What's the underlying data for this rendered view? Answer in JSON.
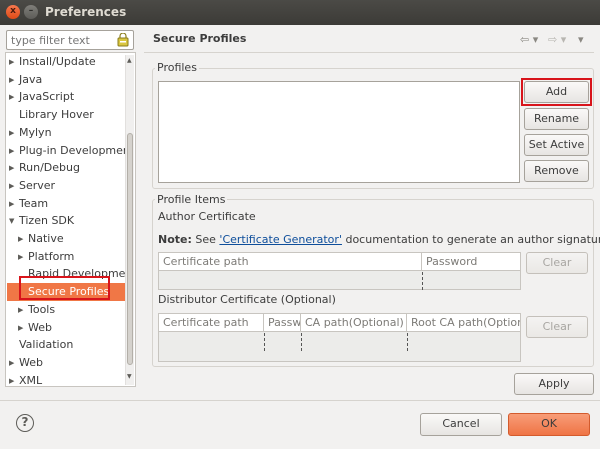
{
  "window": {
    "title": "Preferences",
    "close_glyph": "x",
    "min_glyph": "–"
  },
  "filter": {
    "placeholder": "type filter text",
    "icon": "clear-filter-icon"
  },
  "tree": {
    "items": [
      {
        "label": "Install/Update",
        "expandable": true
      },
      {
        "label": "Java",
        "expandable": true
      },
      {
        "label": "JavaScript",
        "expandable": true
      },
      {
        "label": "Library Hover",
        "expandable": false
      },
      {
        "label": "Mylyn",
        "expandable": true
      },
      {
        "label": "Plug-in Developmen",
        "expandable": true
      },
      {
        "label": "Run/Debug",
        "expandable": true
      },
      {
        "label": "Server",
        "expandable": true
      },
      {
        "label": "Team",
        "expandable": true
      },
      {
        "label": "Tizen SDK",
        "expandable": true,
        "expanded": true
      },
      {
        "label": "Native",
        "expandable": true
      },
      {
        "label": "Platform",
        "expandable": true
      },
      {
        "label": "Rapid Developmen",
        "expandable": false
      },
      {
        "label": "Secure Profiles",
        "expandable": false,
        "selected": true
      },
      {
        "label": "Tools",
        "expandable": true
      },
      {
        "label": "Web",
        "expandable": true
      },
      {
        "label": "Validation",
        "expandable": false
      },
      {
        "label": "Web",
        "expandable": true
      },
      {
        "label": "XML",
        "expandable": true
      }
    ]
  },
  "page": {
    "title": "Secure Profiles",
    "nav_back": "⇦ ▾",
    "nav_forward": "⇨ ▾",
    "menu": "▾"
  },
  "profiles": {
    "group_label": "Profiles",
    "buttons": {
      "add": "Add",
      "rename": "Rename",
      "set_active": "Set Active",
      "remove": "Remove"
    }
  },
  "profile_items": {
    "group_label": "Profile Items",
    "author_label": "Author Certificate",
    "note_prefix": "Note:",
    "note_see": "See",
    "note_link": "'Certificate Generator'",
    "note_suffix": "documentation to generate an author signature.",
    "author_table": {
      "columns": [
        "Certificate path",
        "Password"
      ],
      "clear": "Clear"
    },
    "distributor_label": "Distributor Certificate (Optional)",
    "distributor_table": {
      "columns": [
        "Certificate path",
        "Passw",
        "CA path(Optional)",
        "Root CA path(Optior"
      ],
      "clear": "Clear"
    }
  },
  "footer": {
    "apply": "Apply",
    "cancel": "Cancel",
    "ok": "OK",
    "help_glyph": "?"
  },
  "colors": {
    "selection": "#f07746",
    "highlight_box": "#d8141b",
    "link": "#0e4e9b"
  }
}
